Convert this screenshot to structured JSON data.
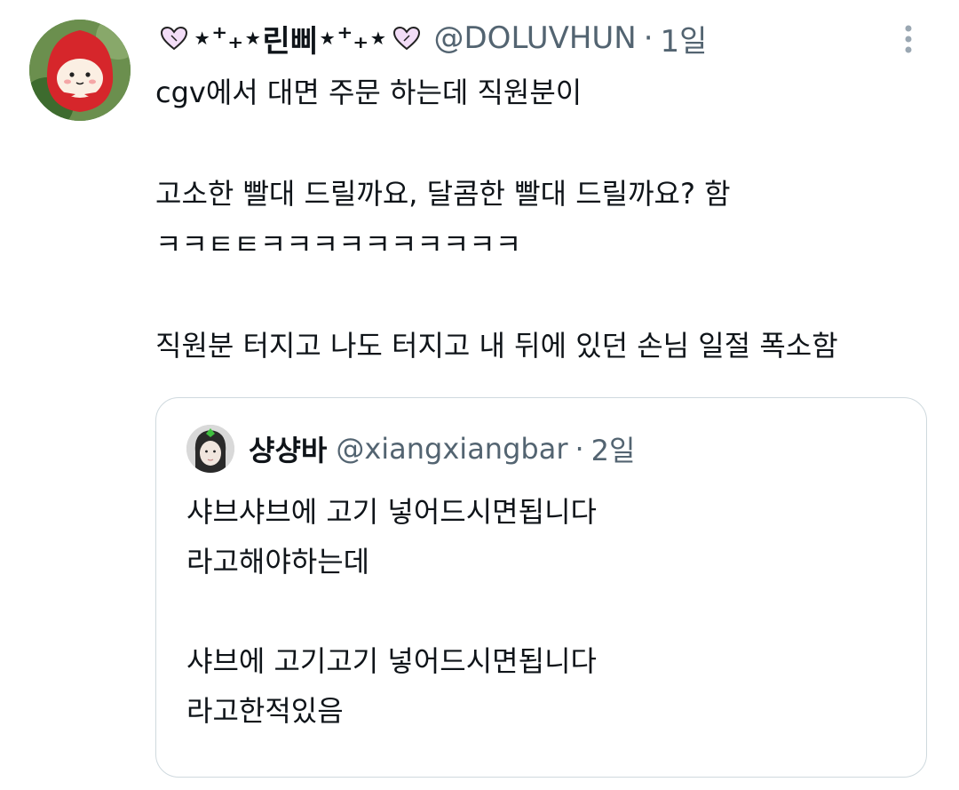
{
  "tweet": {
    "display_name_prefix": "⋆⁺₊⋆",
    "display_name_core": "린삐",
    "display_name_suffix": "⋆⁺₊⋆",
    "handle": "@DOLUVHUN",
    "separator": "·",
    "time": "1일",
    "lines": [
      "cgv에서 대면 주문 하는데 직원분이",
      "",
      "고소한 빨대 드릴까요, 달콤한 빨대 드릴까요? 함",
      "ㅋㅋㅌㅌㅋㅋㅋㅋㅋㅋㅋㅋㅋㅋ",
      "",
      "직원분 터지고 나도 터지고 내 뒤에 있던 손님 일절 폭소함"
    ]
  },
  "quoted": {
    "display_name": "샹샹바",
    "handle": "@xiangxiangbar",
    "separator": "·",
    "time": "2일",
    "lines": [
      "샤브샤브에 고기 넣어드시면됩니다",
      "라고해야하는데",
      "",
      "샤브에 고기고기 넣어드시면됩니다",
      "라고한적있음"
    ]
  },
  "icons": {
    "heart": "heart-icon",
    "more": "more-icon"
  },
  "colors": {
    "text_primary": "#0f1419",
    "text_secondary": "#536471",
    "border": "#cfd9de",
    "heart_fill": "#f3ddf7",
    "heart_stroke": "#222222"
  }
}
